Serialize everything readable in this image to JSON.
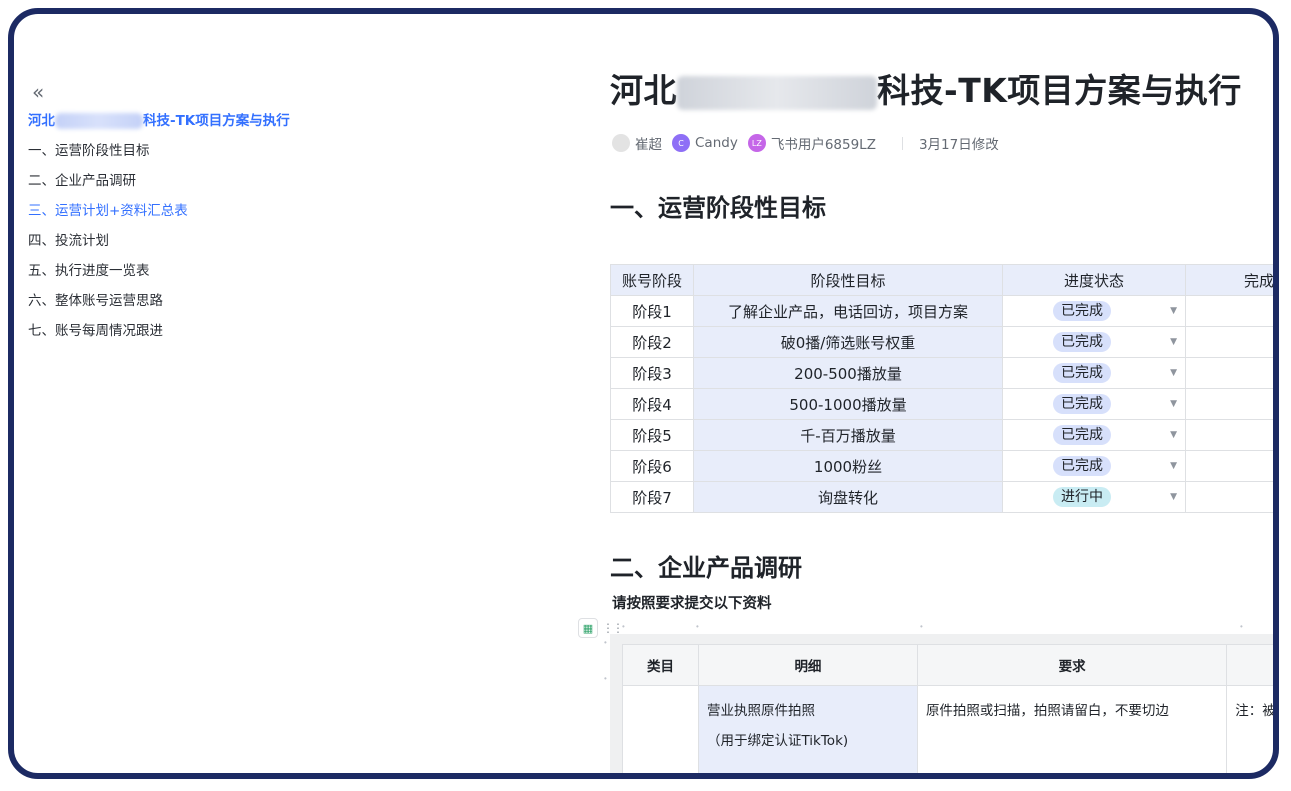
{
  "sidebar": {
    "collapse_label": "«",
    "doc_title_prefix": "河北",
    "doc_title_suffix": "科技-TK项目方案与执行",
    "items": [
      {
        "label": "一、运营阶段性目标",
        "active": false
      },
      {
        "label": "二、企业产品调研",
        "active": false
      },
      {
        "label": "三、运营计划+资料汇总表",
        "active": true
      },
      {
        "label": "四、投流计划",
        "active": false
      },
      {
        "label": "五、执行进度一览表",
        "active": false
      },
      {
        "label": "六、整体账号运营思路",
        "active": false
      },
      {
        "label": "七、账号每周情况跟进",
        "active": false
      }
    ]
  },
  "doc": {
    "title_prefix": "河北",
    "title_suffix": "科技-TK项目方案与执行",
    "authors": [
      {
        "name": "崔超",
        "avatar_text": ""
      },
      {
        "name": "Candy",
        "avatar_text": "C"
      },
      {
        "name": "飞书用户6859LZ",
        "avatar_text": "LZ"
      }
    ],
    "modified": "3月17日修改",
    "section1": "一、运营阶段性目标",
    "section2": "二、企业产品调研",
    "section2_sub": "请按照要求提交以下资料"
  },
  "goals_table": {
    "headers": [
      "账号阶段",
      "阶段性目标",
      "进度状态",
      "完成"
    ],
    "rows": [
      {
        "stage": "阶段1",
        "goal": "了解企业产品，电话回访，项目方案",
        "status": "已完成"
      },
      {
        "stage": "阶段2",
        "goal": "破0播/筛选账号权重",
        "status": "已完成"
      },
      {
        "stage": "阶段3",
        "goal": "200-500播放量",
        "status": "已完成"
      },
      {
        "stage": "阶段4",
        "goal": "500-1000播放量",
        "status": "已完成"
      },
      {
        "stage": "阶段5",
        "goal": "千-百万播放量",
        "status": "已完成"
      },
      {
        "stage": "阶段6",
        "goal": "1000粉丝",
        "status": "已完成"
      },
      {
        "stage": "阶段7",
        "goal": "询盘转化",
        "status": "进行中"
      }
    ]
  },
  "req_table": {
    "headers": [
      "类目",
      "明细",
      "要求"
    ],
    "row": {
      "category": "",
      "detail_line1": "营业执照原件拍照",
      "detail_line2": "（用于绑定认证TikTok)",
      "requirement": "原件拍照或扫描，拍照请留白，不要切边",
      "note": "注：被"
    }
  },
  "colors": {
    "frame": "#1c2a63",
    "accent": "#3370ff",
    "done_badge": "#d7e0fb",
    "progress_badge": "#c9ecf3"
  }
}
